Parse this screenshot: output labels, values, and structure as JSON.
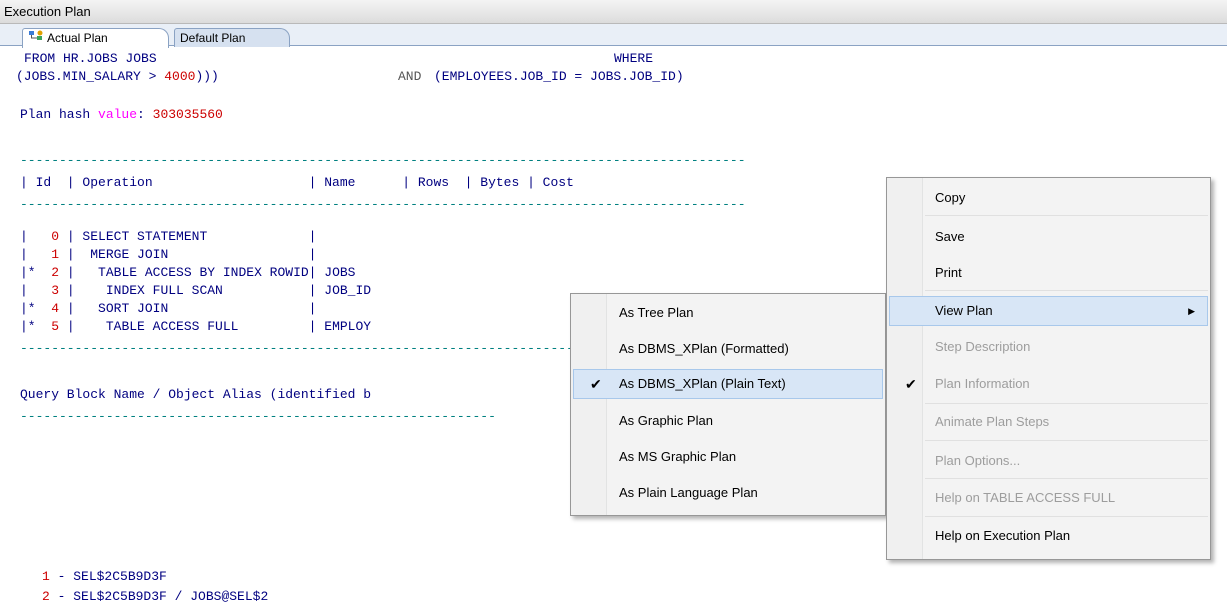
{
  "window": {
    "title": "Execution Plan"
  },
  "tabs": [
    {
      "label": "Actual Plan",
      "active": true,
      "icon": "plan-icon"
    },
    {
      "label": "Default Plan",
      "active": false
    }
  ],
  "code": {
    "line1a": "FROM HR.JOBS JOBS",
    "line1b": "WHERE",
    "line2a": "(JOBS.MIN_SALARY > ",
    "line2num": "4000",
    "line2b": ")))",
    "line2and": "AND",
    "line2c": "(EMPLOYEES.JOB_ID = JOBS.JOB_ID)",
    "hash_label": "Plan hash ",
    "hash_value_word": "value",
    "hash_colon": ": ",
    "hash_number": "303035560",
    "dashes": "---------------------------------------------------------------------------------------------",
    "header": "| Id  | Operation                    | Name      | Rows  | Bytes | Cost",
    "rows": [
      {
        "prefix": "|   ",
        "id": "0",
        "rest": " | SELECT STATEMENT             |"
      },
      {
        "prefix": "|   ",
        "id": "1",
        "rest": " |  MERGE JOIN                  |"
      },
      {
        "prefix": "|*  ",
        "id": "2",
        "rest": " |   TABLE ACCESS BY INDEX ROWID| JOBS"
      },
      {
        "prefix": "|   ",
        "id": "3",
        "rest": " |    INDEX FULL SCAN           | JOB_ID"
      },
      {
        "prefix": "|*  ",
        "id": "4",
        "rest": " |   SORT JOIN                  |"
      },
      {
        "prefix": "|*  ",
        "id": "5",
        "rest": " |    TABLE ACCESS FULL         | EMPLOY"
      }
    ],
    "qb_title": "Query Block Name / Object Alias (identified b",
    "qb_dashes": "-------------------------------------------------------------",
    "qb_rows": [
      {
        "num": "1",
        "text": " - SEL$2C5B9D3F"
      },
      {
        "num": "2",
        "text": " - SEL$2C5B9D3F / JOBS@SEL$2"
      }
    ]
  },
  "context_menu": {
    "items": [
      {
        "label": "Copy",
        "enabled": true
      },
      {
        "label": "Save",
        "enabled": true
      },
      {
        "label": "Print",
        "enabled": true
      },
      {
        "label": "View Plan",
        "enabled": true,
        "submenu": true,
        "highlighted": true
      },
      {
        "label": "Step Description",
        "enabled": false
      },
      {
        "label": "Plan Information",
        "enabled": false,
        "checked": true
      },
      {
        "label": "Animate Plan Steps",
        "enabled": false
      },
      {
        "label": "Plan Options...",
        "enabled": false
      },
      {
        "label": "Help on TABLE ACCESS FULL",
        "enabled": false
      },
      {
        "label": "Help on Execution Plan",
        "enabled": true
      }
    ],
    "check_glyph": "✔",
    "arrow_glyph": "▶"
  },
  "submenu": {
    "items": [
      {
        "label": "As Tree Plan"
      },
      {
        "label": "As DBMS_XPlan (Formatted)"
      },
      {
        "label": "As DBMS_XPlan (Plain Text)",
        "checked": true,
        "highlighted": true
      },
      {
        "label": "As Graphic Plan"
      },
      {
        "label": "As MS Graphic Plan"
      },
      {
        "label": "As Plain Language Plan"
      }
    ]
  }
}
